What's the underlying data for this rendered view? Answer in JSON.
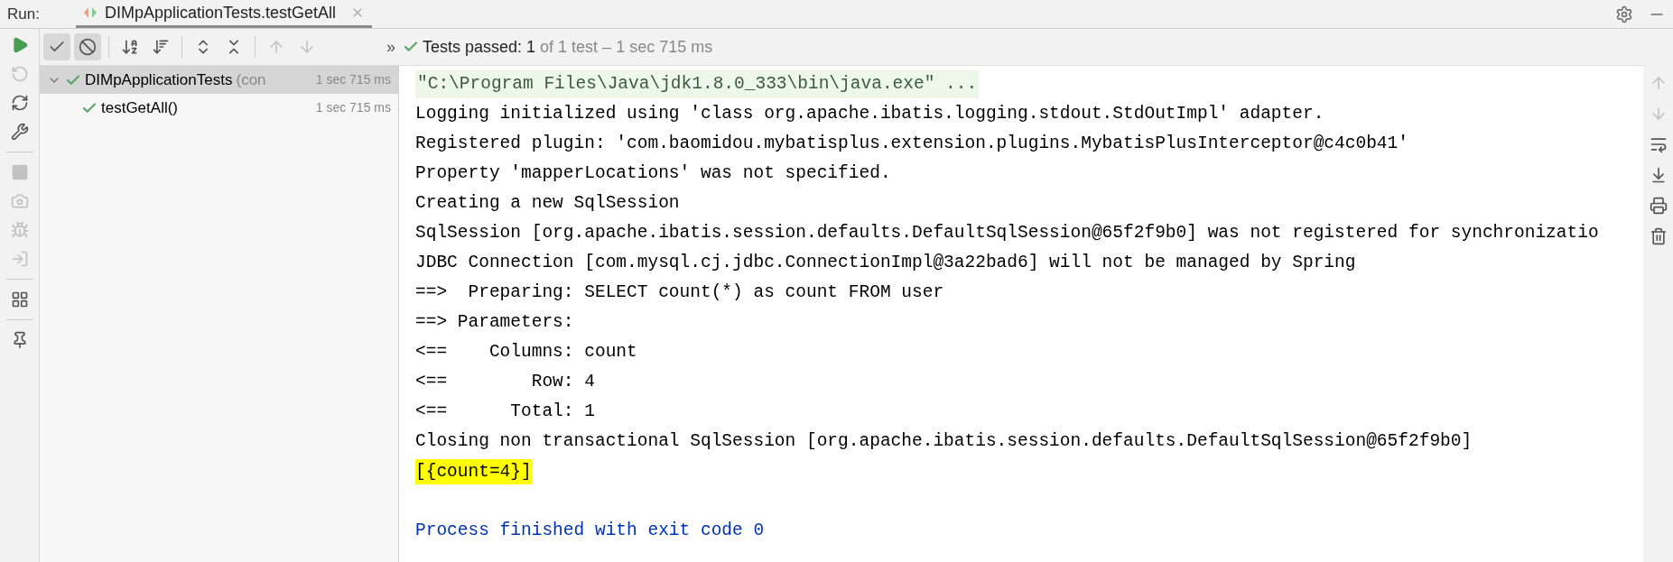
{
  "run_bar": {
    "label": "Run:",
    "tab": {
      "title": "DIMpApplicationTests.testGetAll",
      "selected": true
    }
  },
  "left_tools": [
    {
      "kind": "run",
      "disabled": false
    },
    {
      "kind": "rerun-failed",
      "disabled": true
    },
    {
      "kind": "toggle-auto",
      "disabled": false
    },
    {
      "kind": "settings",
      "disabled": false
    },
    {
      "kind": "divider"
    },
    {
      "kind": "stop",
      "disabled": true
    },
    {
      "kind": "snapshot",
      "disabled": true
    },
    {
      "kind": "debug-export",
      "disabled": true
    },
    {
      "kind": "import",
      "disabled": true
    },
    {
      "kind": "divider"
    },
    {
      "kind": "layout",
      "disabled": false
    },
    {
      "kind": "divider"
    },
    {
      "kind": "pin",
      "disabled": false
    }
  ],
  "test_toolbar": [
    {
      "kind": "show-passed",
      "selected": true
    },
    {
      "kind": "show-ignored",
      "selected": true
    },
    {
      "kind": "divider"
    },
    {
      "kind": "sort-alpha",
      "selected": false
    },
    {
      "kind": "sort-duration",
      "selected": false
    },
    {
      "kind": "divider"
    },
    {
      "kind": "expand-all",
      "selected": false
    },
    {
      "kind": "collapse-all",
      "selected": false
    },
    {
      "kind": "divider"
    },
    {
      "kind": "previous",
      "selected": false
    },
    {
      "kind": "next",
      "selected": false
    }
  ],
  "more": "»",
  "status": {
    "label": "Tests passed: ",
    "count": "1",
    "detail": " of 1 test – 1 sec 715 ms"
  },
  "tree": [
    {
      "name": "DIMpApplicationTests",
      "note": "(con",
      "time": "1 sec 715 ms",
      "selected": true,
      "expanded": true,
      "children": [
        {
          "name": "testGetAll()",
          "time": "1 sec 715 ms",
          "selected": false
        }
      ]
    }
  ],
  "console": [
    {
      "kind": "command",
      "text": "\"C:\\Program Files\\Java\\jdk1.8.0_333\\bin\\java.exe\" ..."
    },
    {
      "kind": "output",
      "text": "Logging initialized using 'class org.apache.ibatis.logging.stdout.StdOutImpl' adapter."
    },
    {
      "kind": "output",
      "text": "Registered plugin: 'com.baomidou.mybatisplus.extension.plugins.MybatisPlusInterceptor@c4c0b41'"
    },
    {
      "kind": "output",
      "text": "Property 'mapperLocations' was not specified."
    },
    {
      "kind": "output",
      "text": "Creating a new SqlSession"
    },
    {
      "kind": "output",
      "text": "SqlSession [org.apache.ibatis.session.defaults.DefaultSqlSession@65f2f9b0] was not registered for synchronizatio"
    },
    {
      "kind": "output",
      "text": "JDBC Connection [com.mysql.cj.jdbc.ConnectionImpl@3a22bad6] will not be managed by Spring"
    },
    {
      "kind": "output",
      "text": "==>  Preparing: SELECT count(*) as count FROM user"
    },
    {
      "kind": "output",
      "text": "==> Parameters: "
    },
    {
      "kind": "output",
      "text": "<==    Columns: count"
    },
    {
      "kind": "output",
      "text": "<==        Row: 4"
    },
    {
      "kind": "output",
      "text": "<==      Total: 1"
    },
    {
      "kind": "output",
      "text": "Closing non transactional SqlSession [org.apache.ibatis.session.defaults.DefaultSqlSession@65f2f9b0]"
    },
    {
      "kind": "highlight",
      "text": "[{count=4}]"
    },
    {
      "kind": "blank"
    },
    {
      "kind": "exit",
      "text": "Process finished with exit code 0"
    }
  ],
  "right_tools": [
    {
      "kind": "up",
      "disabled": true
    },
    {
      "kind": "down",
      "disabled": true
    },
    {
      "kind": "soft-wrap",
      "disabled": false
    },
    {
      "kind": "scroll-end",
      "disabled": false
    },
    {
      "kind": "print",
      "disabled": false
    },
    {
      "kind": "clear",
      "disabled": false
    }
  ]
}
